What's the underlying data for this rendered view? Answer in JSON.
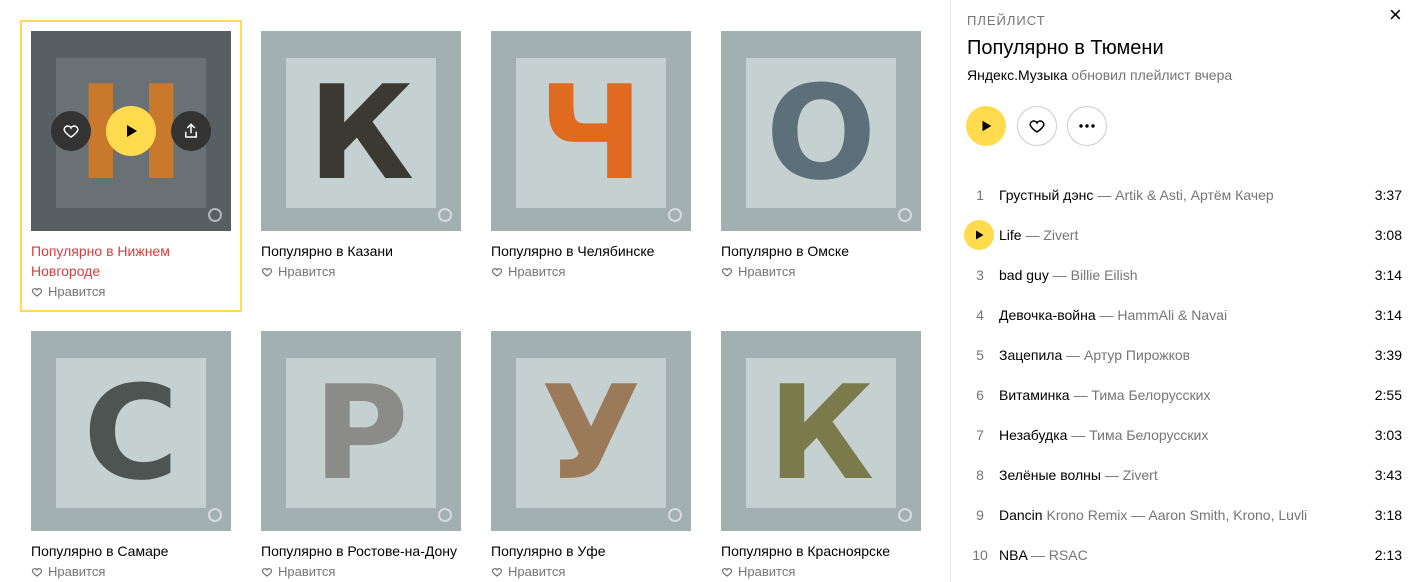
{
  "cards": [
    {
      "title": "Популярно в Нижнем Новгороде",
      "like_label": "Нравится",
      "letter": "Н",
      "letter_color": "#c8792c"
    },
    {
      "title": "Популярно в Казани",
      "like_label": "Нравится",
      "letter": "К",
      "letter_color": "#3a3a33"
    },
    {
      "title": "Популярно в Челябинске",
      "like_label": "Нравится",
      "letter": "Ч",
      "letter_color": "#e06a1f"
    },
    {
      "title": "Популярно в Омске",
      "like_label": "Нравится",
      "letter": "О",
      "letter_color": "#5d6f79"
    },
    {
      "title": "Популярно в Самаре",
      "like_label": "Нравится",
      "letter": "С",
      "letter_color": "#4c5552"
    },
    {
      "title": "Популярно в Ростове-на-Дону",
      "like_label": "Нравится",
      "letter": "Р",
      "letter_color": "#8b8c8a"
    },
    {
      "title": "Популярно в Уфе",
      "like_label": "Нравится",
      "letter": "У",
      "letter_color": "#9b7a5a"
    },
    {
      "title": "Популярно в Красноярске",
      "like_label": "Нравится",
      "letter": "К",
      "letter_color": "#7a7a4b"
    }
  ],
  "panel": {
    "label": "ПЛЕЙЛИСТ",
    "title": "Популярно в Тюмени",
    "owner": "Яндекс.Музыка",
    "updated": "обновил плейлист вчера",
    "close_icon": "×"
  },
  "tracks": [
    {
      "num": "1",
      "title": "Грустный дэнс",
      "version": "",
      "artists": "— Artik & Asti, Артём Качер",
      "duration": "3:37"
    },
    {
      "num": "2",
      "title": "Life",
      "version": "",
      "artists": "— Zivert",
      "duration": "3:08",
      "playing": true
    },
    {
      "num": "3",
      "title": "bad guy",
      "version": "",
      "artists": "— Billie Eilish",
      "duration": "3:14"
    },
    {
      "num": "4",
      "title": "Девочка-война",
      "version": "",
      "artists": "— HammAli & Navai",
      "duration": "3:14"
    },
    {
      "num": "5",
      "title": "Зацепила",
      "version": "",
      "artists": "— Артур Пирожков",
      "duration": "3:39"
    },
    {
      "num": "6",
      "title": "Витаминка",
      "version": "",
      "artists": "— Тима Белорусских",
      "duration": "2:55"
    },
    {
      "num": "7",
      "title": "Незабудка",
      "version": "",
      "artists": "— Тима Белорусских",
      "duration": "3:03"
    },
    {
      "num": "8",
      "title": "Зелёные волны",
      "version": "",
      "artists": "— Zivert",
      "duration": "3:43"
    },
    {
      "num": "9",
      "title": "Dancin",
      "version": "Krono Remix",
      "artists": "— Aaron Smith, Krono, Luvli",
      "duration": "3:18"
    },
    {
      "num": "10",
      "title": "NBA",
      "version": "",
      "artists": "— RSAC",
      "duration": "2:13"
    }
  ],
  "colors": {
    "accent": "#ffdb4d",
    "active_title": "#d93c3c",
    "muted": "#757575"
  }
}
